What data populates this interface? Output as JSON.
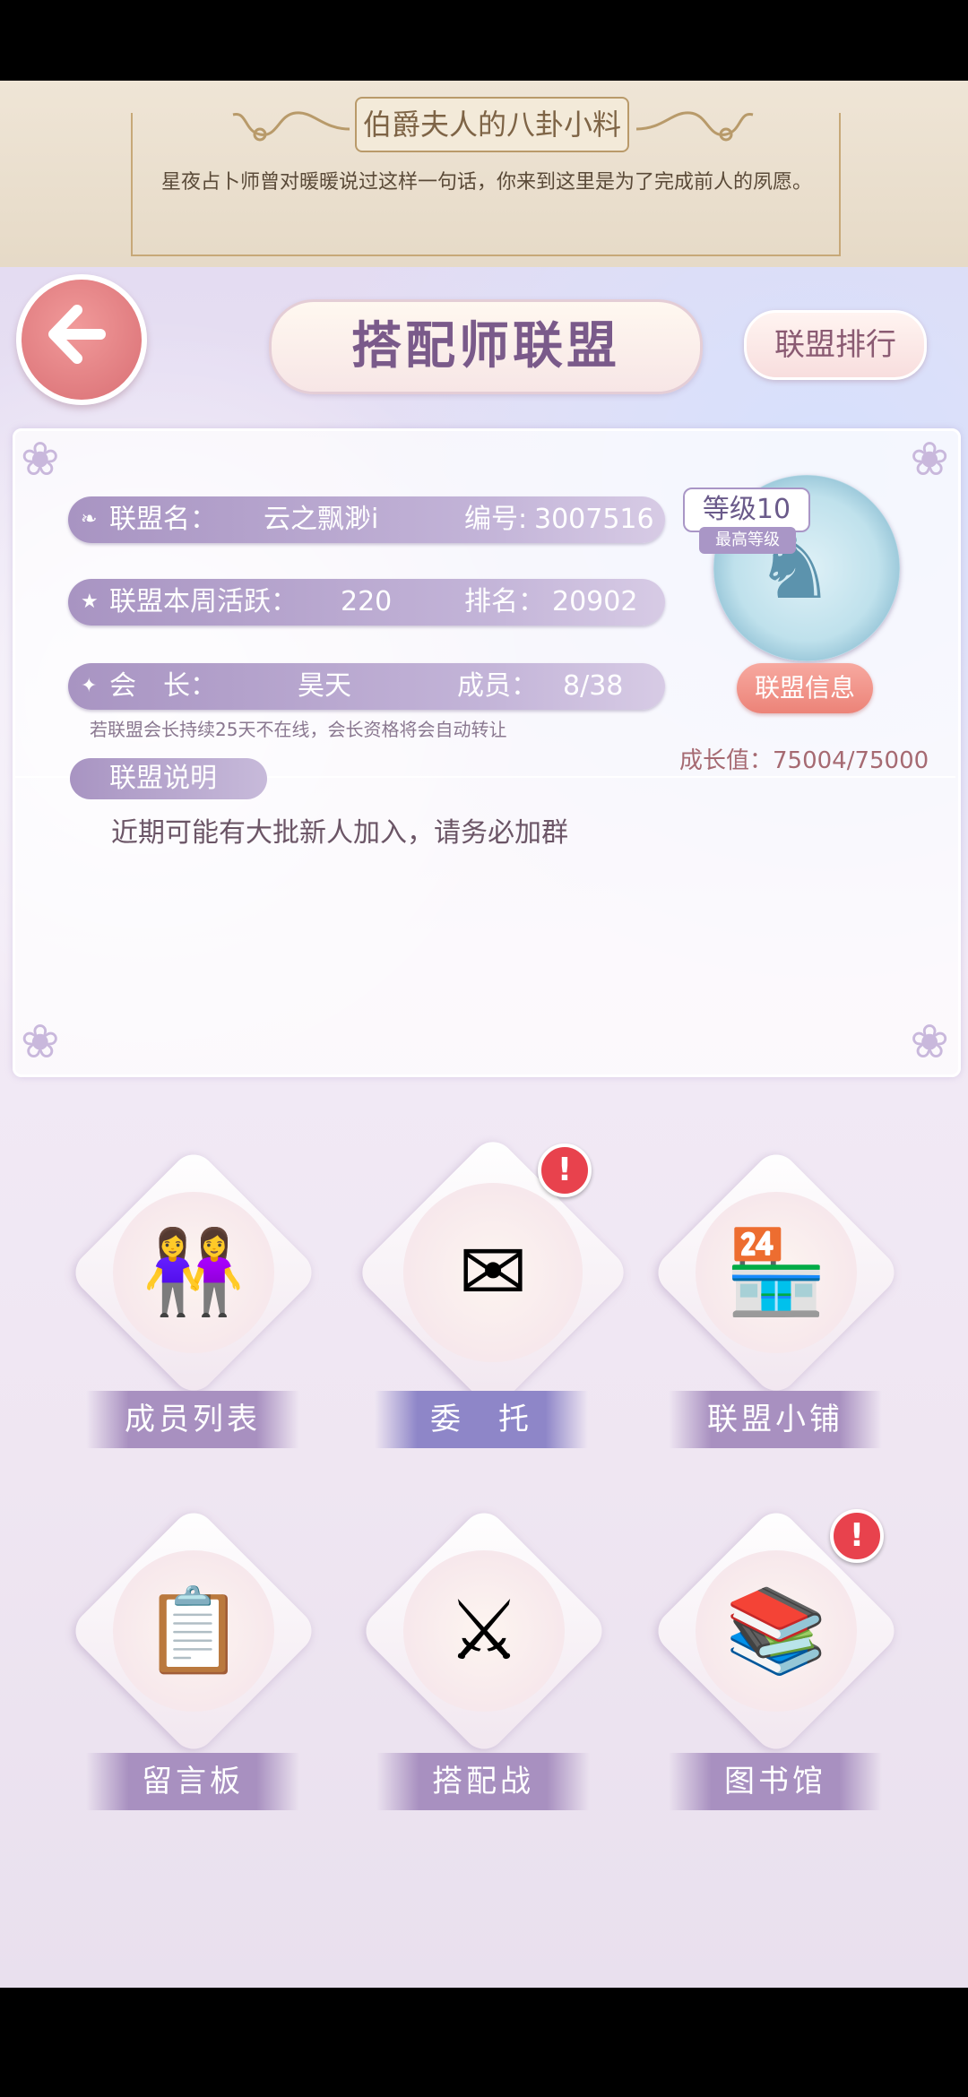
{
  "gossip": {
    "title": "伯爵夫人的八卦小料",
    "text": "星夜占卜师曾对暖暖说过这样一句话，你来到这里是为了完成前人的夙愿。"
  },
  "header": {
    "title": "搭配师联盟",
    "rank_button": "联盟排行"
  },
  "alliance": {
    "name_label": "联盟名：",
    "name_value": "云之飘渺i",
    "id_label": "编号:",
    "id_value": "3007516",
    "weekly_label": "联盟本周活跃：",
    "weekly_value": "220",
    "rank_label": "排名：",
    "rank_value": "20902",
    "leader_label": "会　长：",
    "leader_value": "昊天",
    "members_label": "成员：",
    "members_value": "8/38",
    "leader_note": "若联盟会长持续25天不在线，会长资格将会自动转让",
    "level": "等级10",
    "max_level": "最高等级",
    "info_button": "联盟信息",
    "growth": "成长值：75004/75000",
    "desc_label": "联盟说明",
    "desc_text": "近期可能有大批新人加入，请务必加群"
  },
  "features": {
    "members": "成员列表",
    "commission": "委　托",
    "shop": "联盟小铺",
    "board": "留言板",
    "battle": "搭配战",
    "library": "图书馆"
  },
  "colors": {
    "accent_purple": "#a890c0",
    "alert_red": "#e8424d",
    "back_button": "#d96f74"
  }
}
